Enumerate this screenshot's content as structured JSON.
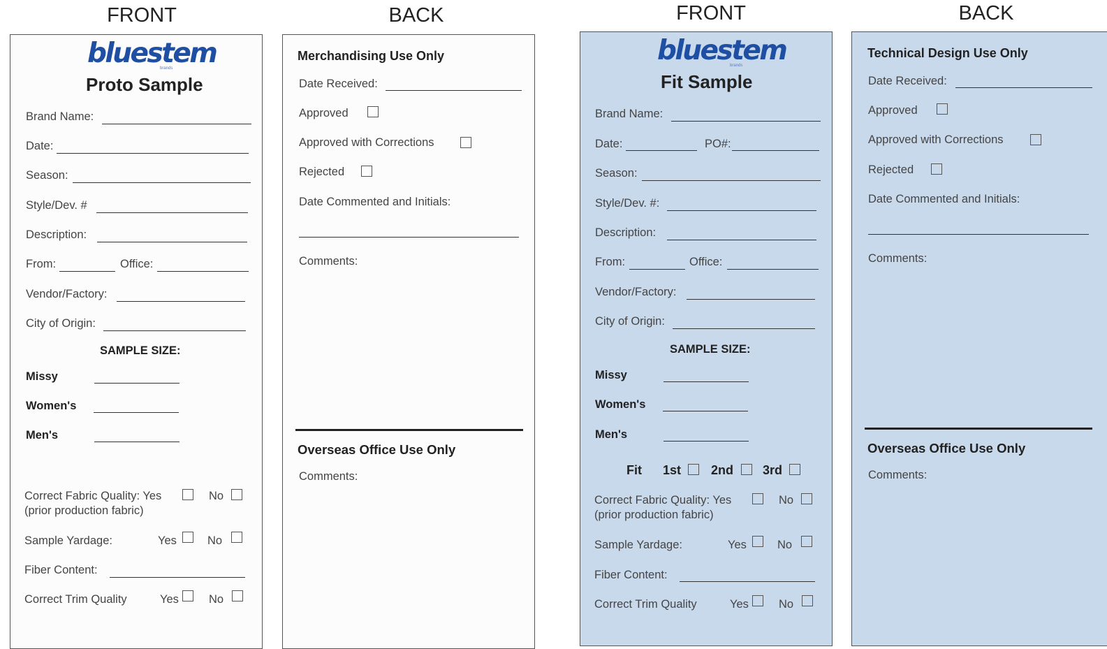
{
  "headings": [
    "FRONT",
    "BACK",
    "FRONT",
    "BACK"
  ],
  "proto_front": {
    "logo": "bluestem",
    "logo_sub": "brands",
    "title": "Proto Sample",
    "brand_name": "Brand Name:",
    "date": "Date:",
    "season": "Season:",
    "style": "Style/Dev. #",
    "description": "Description:",
    "from": "From:",
    "office": "Office:",
    "vendor": "Vendor/Factory:",
    "city": "City of Origin:",
    "sample_size": "SAMPLE SIZE:",
    "missy": "Missy",
    "womens": "Women's",
    "mens": "Men's",
    "fabric_quality": "Correct Fabric Quality: Yes",
    "no": "No",
    "prior_fabric": "(prior production fabric)",
    "sample_yardage": "Sample Yardage:",
    "yes": "Yes",
    "fiber_content": "Fiber Content:",
    "trim_quality": "Correct Trim Quality"
  },
  "merch_back": {
    "title": "Merchandising Use Only",
    "date_received": "Date Received:",
    "approved": "Approved",
    "approved_corrections": "Approved with Corrections",
    "rejected": "Rejected",
    "date_commented": "Date Commented and Initials:",
    "comments": "Comments:",
    "overseas_title": "Overseas Office Use Only",
    "overseas_comments": "Comments:"
  },
  "fit_front": {
    "logo": "bluestem",
    "logo_sub": "brands",
    "title": "Fit Sample",
    "brand_name": "Brand Name:",
    "date": "Date:",
    "po": "PO#:",
    "season": "Season:",
    "style": "Style/Dev. #:",
    "description": "Description:",
    "from": "From:",
    "office": "Office:",
    "vendor": "Vendor/Factory:",
    "city": "City of Origin:",
    "sample_size": "SAMPLE SIZE:",
    "missy": "Missy",
    "womens": "Women's",
    "mens": "Men's",
    "fit": "Fit",
    "first": "1st",
    "second": "2nd",
    "third": "3rd",
    "fabric_quality": "Correct Fabric Quality: Yes",
    "no": "No",
    "prior_fabric": "(prior production fabric)",
    "sample_yardage": "Sample Yardage:",
    "yes": "Yes",
    "fiber_content": "Fiber Content:",
    "trim_quality": "Correct Trim Quality"
  },
  "tech_back": {
    "title": "Technical Design Use Only",
    "date_received": "Date Received:",
    "approved": "Approved",
    "approved_corrections": "Approved with Corrections",
    "rejected": "Rejected",
    "date_commented": "Date Commented and Initials:",
    "comments": "Comments:",
    "overseas_title": "Overseas Office Use Only",
    "overseas_comments": "Comments:"
  },
  "colors": {
    "blue_card": "#c9d9ec",
    "logo": "#1f4fa3"
  }
}
